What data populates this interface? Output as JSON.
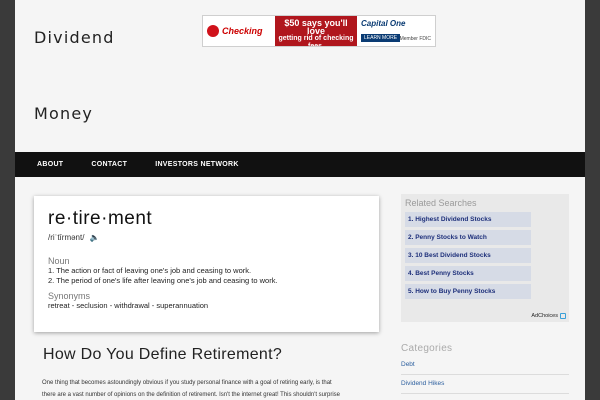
{
  "site": {
    "title_line1": "Dividend",
    "title_line2": "Money"
  },
  "ad_banner": {
    "brand": "Checking",
    "headline_big": "$50 says you'll love",
    "headline_rest": "getting rid of checking fees.",
    "logo": "Capital One",
    "cta": "LEARN MORE",
    "fdic": "Member FDIC"
  },
  "nav": {
    "items": [
      "ABOUT",
      "CONTACT",
      "INVESTORS NETWORK"
    ]
  },
  "dictionary": {
    "word": "re·tire·ment",
    "pronunciation": "/riˈtīrmənt/",
    "pos": "Noun",
    "definitions": [
      "1.  The action or fact of leaving one's job and ceasing to work.",
      "2.  The period of one's life after leaving one's job and ceasing to work."
    ],
    "synonyms_heading": "Synonyms",
    "synonyms": "retreat - seclusion - withdrawal - superannuation"
  },
  "post": {
    "title": "How Do You Define Retirement?",
    "body_line1": "One thing that becomes astoundingly obvious if you study personal finance with a goal of retiring early, is that",
    "body_line2": "there are a vast number of opinions on the definition of retirement. Isn't the internet great! This shouldn't surprise"
  },
  "sidebar": {
    "related_heading": "Related Searches",
    "related": [
      "1. Highest Dividend Stocks",
      "2. Penny Stocks to Watch",
      "3. 10 Best Dividend Stocks",
      "4. Best Penny Stocks",
      "5. How to Buy Penny Stocks"
    ],
    "adchoices": "AdChoices",
    "categories_heading": "Categories",
    "categories": [
      "Debt",
      "Dividend Hikes"
    ]
  }
}
